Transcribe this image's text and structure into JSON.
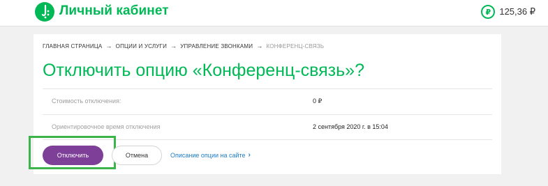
{
  "header": {
    "brand": "Личный кабинет",
    "balance": "125,36 ₽",
    "balance_icon": "₽"
  },
  "breadcrumb": {
    "items": [
      "ГЛАВНАЯ СТРАНИЦА",
      "ОПЦИИ И УСЛУГИ",
      "УПРАВЛЕНИЕ ЗВОНКАМИ"
    ],
    "current": "КОНФЕРЕНЦ-СВЯЗЬ",
    "separator": "→"
  },
  "page": {
    "title": "Отключить опцию «Конференц-связь»?"
  },
  "info": [
    {
      "label": "Стоимость отключения:",
      "value": "0 ₽"
    },
    {
      "label": "Ориентировочное время отключения",
      "value": "2 сентября 2020 г. в 15:04"
    }
  ],
  "actions": {
    "disable_label": "Отключить",
    "cancel_label": "Отмена",
    "description_link": "Описание опции на сайте",
    "link_chevron": "›"
  },
  "colors": {
    "brand_green": "#00b956",
    "primary_purple": "#7d3f98",
    "link_blue": "#1e7cc5",
    "highlight": "#3bb54a"
  }
}
